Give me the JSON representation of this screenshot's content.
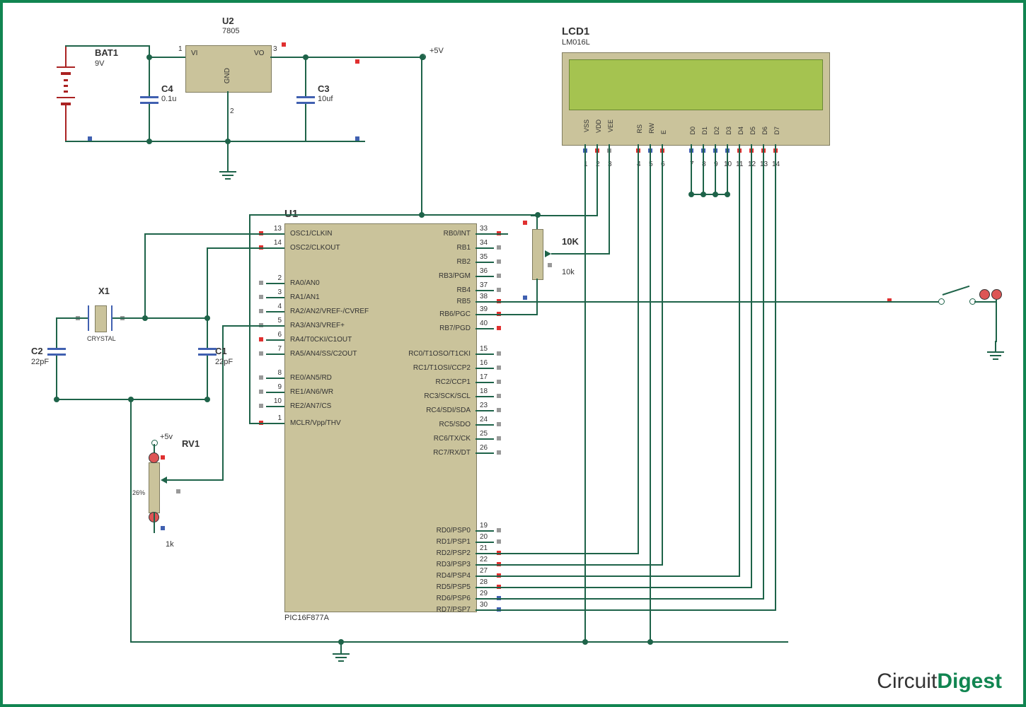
{
  "power": {
    "bat": {
      "ref": "BAT1",
      "value": "9V"
    },
    "reg": {
      "ref": "U2",
      "part": "7805",
      "pin_vi": "VI",
      "pin_vo": "VO",
      "pin_gnd": "GND",
      "n1": "1",
      "n2": "2",
      "n3": "3"
    },
    "c4": {
      "ref": "C4",
      "value": "0.1u"
    },
    "c3": {
      "ref": "C3",
      "value": "10uf"
    },
    "rail": "+5V"
  },
  "mcu": {
    "ref": "U1",
    "part": "PIC16F877A",
    "left": [
      {
        "n": "13",
        "name": "OSC1/CLKIN"
      },
      {
        "n": "14",
        "name": "OSC2/CLKOUT"
      },
      {
        "n": "2",
        "name": "RA0/AN0"
      },
      {
        "n": "3",
        "name": "RA1/AN1"
      },
      {
        "n": "4",
        "name": "RA2/AN2/VREF-/CVREF"
      },
      {
        "n": "5",
        "name": "RA3/AN3/VREF+"
      },
      {
        "n": "6",
        "name": "RA4/T0CKI/C1OUT"
      },
      {
        "n": "7",
        "name": "RA5/AN4/SS/C2OUT"
      },
      {
        "n": "8",
        "name": "RE0/AN5/RD"
      },
      {
        "n": "9",
        "name": "RE1/AN6/WR"
      },
      {
        "n": "10",
        "name": "RE2/AN7/CS"
      },
      {
        "n": "1",
        "name": "MCLR/Vpp/THV"
      }
    ],
    "right": [
      {
        "n": "33",
        "name": "RB0/INT"
      },
      {
        "n": "34",
        "name": "RB1"
      },
      {
        "n": "35",
        "name": "RB2"
      },
      {
        "n": "36",
        "name": "RB3/PGM"
      },
      {
        "n": "37",
        "name": "RB4"
      },
      {
        "n": "38",
        "name": "RB5"
      },
      {
        "n": "39",
        "name": "RB6/PGC"
      },
      {
        "n": "40",
        "name": "RB7/PGD"
      },
      {
        "n": "15",
        "name": "RC0/T1OSO/T1CKI"
      },
      {
        "n": "16",
        "name": "RC1/T1OSI/CCP2"
      },
      {
        "n": "17",
        "name": "RC2/CCP1"
      },
      {
        "n": "18",
        "name": "RC3/SCK/SCL"
      },
      {
        "n": "23",
        "name": "RC4/SDI/SDA"
      },
      {
        "n": "24",
        "name": "RC5/SDO"
      },
      {
        "n": "25",
        "name": "RC6/TX/CK"
      },
      {
        "n": "26",
        "name": "RC7/RX/DT"
      },
      {
        "n": "19",
        "name": "RD0/PSP0"
      },
      {
        "n": "20",
        "name": "RD1/PSP1"
      },
      {
        "n": "21",
        "name": "RD2/PSP2"
      },
      {
        "n": "22",
        "name": "RD3/PSP3"
      },
      {
        "n": "27",
        "name": "RD4/PSP4"
      },
      {
        "n": "28",
        "name": "RD5/PSP5"
      },
      {
        "n": "29",
        "name": "RD6/PSP6"
      },
      {
        "n": "30",
        "name": "RD7/PSP7"
      }
    ]
  },
  "lcd": {
    "ref": "LCD1",
    "part": "LM016L",
    "pins": [
      "VSS",
      "VDD",
      "VEE",
      "RS",
      "RW",
      "E",
      "D0",
      "D1",
      "D2",
      "D3",
      "D4",
      "D5",
      "D6",
      "D7"
    ],
    "nums": [
      "1",
      "2",
      "3",
      "4",
      "5",
      "6",
      "7",
      "8",
      "9",
      "10",
      "11",
      "12",
      "13",
      "14"
    ]
  },
  "osc": {
    "x1": {
      "ref": "X1",
      "value": "CRYSTAL"
    },
    "c1": {
      "ref": "C1",
      "value": "22pF"
    },
    "c2": {
      "ref": "C2",
      "value": "22pF"
    }
  },
  "pots": {
    "rv1": {
      "ref": "RV1",
      "value": "1k",
      "pos": "26%",
      "rail": "+5v"
    },
    "tenk": {
      "ref": "10K",
      "value": "10k"
    }
  },
  "logo": {
    "a": "Circuit",
    "b": "Digest"
  }
}
